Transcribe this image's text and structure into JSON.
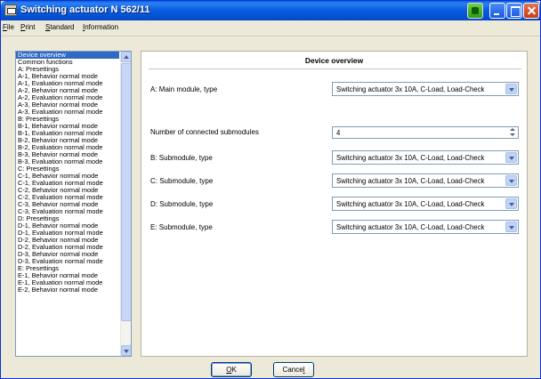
{
  "window": {
    "title": "Switching actuator N 562/11"
  },
  "menu": [
    {
      "label": "File",
      "accel": "F",
      "rest": "ile"
    },
    {
      "label": "Print",
      "accel": "P",
      "rest": "rint"
    },
    {
      "label": "Standard",
      "accel": "S",
      "rest": "tandard"
    },
    {
      "label": "Information",
      "accel": "I",
      "rest": "nformation"
    }
  ],
  "sidebar": {
    "items": [
      "Device overview",
      "Common functions",
      "A: Presettings",
      "A-1, Behavior normal mode",
      "A-1, Evaluation normal mode",
      "A-2, Behavior normal mode",
      "A-2, Evaluation normal mode",
      "A-3, Behavior normal mode",
      "A-3, Evaluation normal mode",
      "B: Presettings",
      "B-1, Behavior normal mode",
      "B-1, Evaluation normal mode",
      "B-2, Behavior normal mode",
      "B-2, Evaluation normal mode",
      "B-3, Behavior normal mode",
      "B-3, Evaluation normal mode",
      "C: Presettings",
      "C-1, Behavior normal mode",
      "C-1, Evaluation normal mode",
      "C-2, Behavior normal mode",
      "C-2, Evaluation normal mode",
      "C-3, Behavior normal mode",
      "C-3, Evaluation normal mode",
      "D: Presettings",
      "D-1, Behavior normal mode",
      "D-1, Evaluation normal mode",
      "D-2, Behavior normal mode",
      "D-2, Evaluation normal mode",
      "D-3, Behavior normal mode",
      "D-3, Evaluation normal mode",
      "E: Presettings",
      "E-1, Behavior normal mode",
      "E-1, Evaluation normal mode",
      "E-2, Behavior normal mode"
    ],
    "selected_index": 0
  },
  "panel": {
    "title": "Device overview",
    "main_module_label": "A: Main module, type",
    "main_module_value": "Switching actuator 3x 10A, C-Load, Load-Check",
    "submodules_count_label": "Number of connected submodules",
    "submodules_count_value": "4",
    "sub_b_label": "B: Submodule, type",
    "sub_b_value": "Switching actuator 3x 10A, C-Load, Load-Check",
    "sub_c_label": "C: Submodule, type",
    "sub_c_value": "Switching actuator 3x 10A, C-Load, Load-Check",
    "sub_d_label": "D: Submodule, type",
    "sub_d_value": "Switching actuator 3x 10A, C-Load, Load-Check",
    "sub_e_label": "E: Submodule, type",
    "sub_e_value": "Switching actuator 3x 10A, C-Load, Load-Check"
  },
  "buttons": {
    "ok_accel": "O",
    "ok_rest": "K",
    "cancel_prefix": "Cance",
    "cancel_accel": "l"
  },
  "colors": {
    "selection": "#316ac5",
    "titlebar": "#0a5ee0"
  }
}
